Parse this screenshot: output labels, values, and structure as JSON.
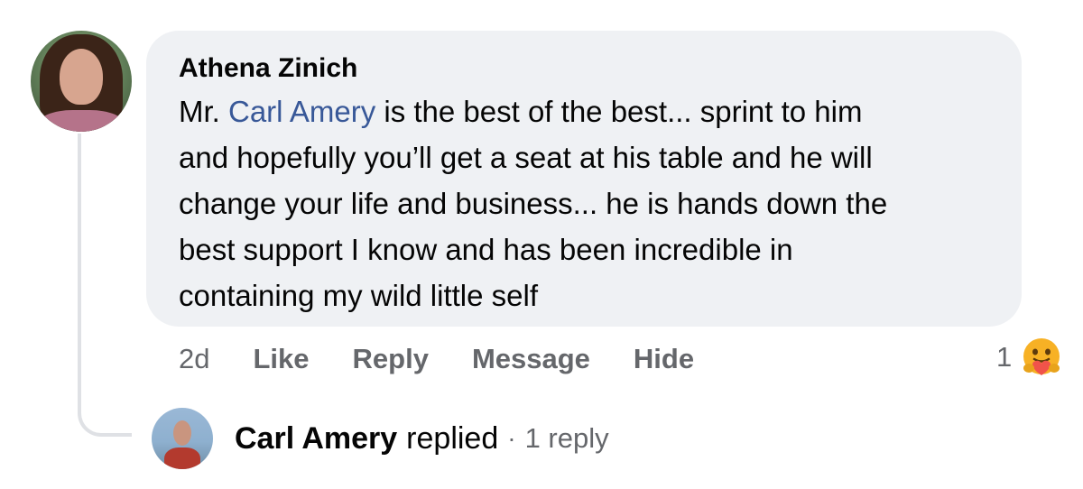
{
  "comment": {
    "author": "Athena Zinich",
    "text_prefix": "Mr. ",
    "mention": "Carl Amery",
    "lines": [
      " is the best of the best... sprint to him",
      "and hopefully you’ll get a seat at his table and he will",
      "change your life and business... he is hands down the",
      "best support I know and has been incredible in",
      "containing my wild little self"
    ]
  },
  "actions": {
    "time": "2d",
    "like": "Like",
    "reply": "Reply",
    "message": "Message",
    "hide": "Hide"
  },
  "reactions": {
    "count": "1",
    "icon": "care-reaction-icon"
  },
  "reply_summary": {
    "name": "Carl Amery",
    "verb": "replied",
    "separator": "·",
    "count": "1 reply"
  },
  "colors": {
    "bubble": "#eff1f4",
    "mention": "#385898",
    "secondary_text": "#65676b"
  }
}
